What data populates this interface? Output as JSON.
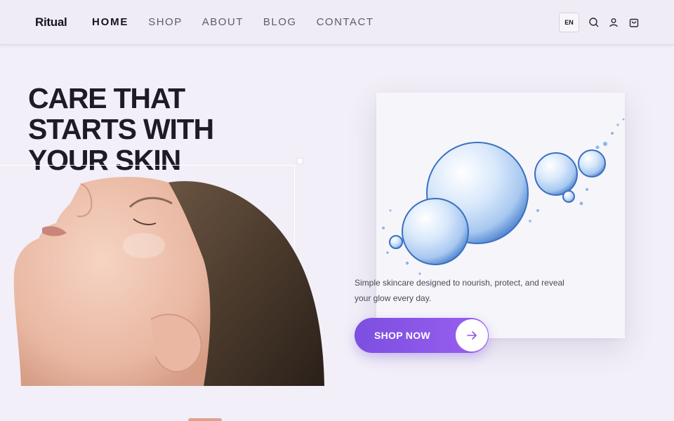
{
  "brand": {
    "logo_text": "Ritual"
  },
  "nav": {
    "items": [
      {
        "label": "HOME",
        "active": true
      },
      {
        "label": "SHOP",
        "active": false
      },
      {
        "label": "ABOUT",
        "active": false
      },
      {
        "label": "BLOG",
        "active": false
      },
      {
        "label": "CONTACT",
        "active": false
      }
    ]
  },
  "header_actions": {
    "language": "EN",
    "icons": [
      "search-icon",
      "user-icon",
      "bag-icon"
    ]
  },
  "hero": {
    "title_lines": [
      "CARE THAT",
      "STARTS WITH",
      "YOUR SKIN"
    ],
    "description": "Simple skincare designed to nourish, protect, and reveal your glow every day.",
    "cta": {
      "label": "SHOP NOW",
      "icon": "arrow-right-icon"
    }
  },
  "colors": {
    "background": "#f2eff8",
    "accent": "#8a55e8",
    "text": "#1e1b28"
  }
}
